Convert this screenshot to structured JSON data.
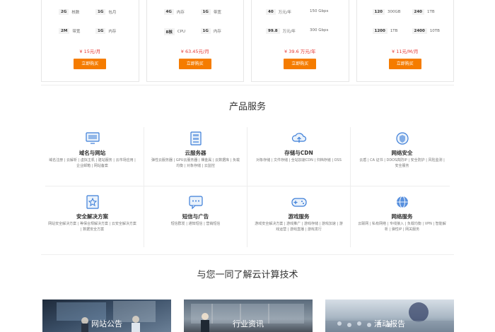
{
  "pricing": [
    {
      "specs": [
        [
          "2G",
          "核数"
        ],
        [
          "1G",
          "包月"
        ],
        [
          "2M",
          "带宽"
        ],
        [
          "1G",
          "内存"
        ]
      ],
      "price": "¥ 15元/月",
      "buy": "立即购买"
    },
    {
      "specs": [
        [
          "4G",
          "内存"
        ],
        [
          "1G",
          "带宽"
        ],
        [
          "8核",
          "CPU"
        ],
        [
          "1G",
          "内存"
        ]
      ],
      "price": "¥ 63.45元/月",
      "buy": "立即购买"
    },
    {
      "specs": [
        [
          "40",
          "万元/年"
        ],
        [
          "150 Gbps",
          ""
        ],
        [
          "99.8",
          "万元/年"
        ],
        [
          "300 Gbps",
          ""
        ]
      ],
      "price": "¥ 39.6 万元/年",
      "buy": "立即购买"
    },
    {
      "specs": [
        [
          "120",
          "300GB"
        ],
        [
          "240",
          "1TB"
        ],
        [
          "1200",
          "1TB"
        ],
        [
          "2400",
          "10TB"
        ]
      ],
      "price": "¥ 11元/M/月",
      "buy": "立即购买"
    }
  ],
  "products_title": "产品服务",
  "products": [
    {
      "name": "域名与网站",
      "icon": "monitor-icon",
      "desc": "域名注册 | 云解析 | 虚拟主机 | 建站服务 | 云市场应用 | 企业邮箱 | 网站备案"
    },
    {
      "name": "云服务器",
      "icon": "server-icon",
      "desc": "弹性云服务器 | GPU云服务器 | 裸金属 | 云数据库 | 负载均衡 | 对象存储 | 云监控"
    },
    {
      "name": "存储与CDN",
      "icon": "cloud-upload-icon",
      "desc": "对象存储 | 文件存储 | 全站加速CDN | 归档存储 | OSS"
    },
    {
      "name": "网络安全",
      "icon": "shield-icon",
      "desc": "云盾 | CA 证书 | DDOS高防IP | 安全防护 | 风险监测 | 安全服务"
    },
    {
      "name": "安全解决方案",
      "icon": "star-icon",
      "desc": "网站安全解决方案 | 等保合规解决方案 | 云安全解决方案 | 数据安全方案"
    },
    {
      "name": "短信与广告",
      "icon": "chat-icon",
      "desc": "短信群发 | 通知短信 | 营销短信"
    },
    {
      "name": "游戏服务",
      "icon": "gamepad-icon",
      "desc": "游戏安全解决方案 | 游戏推广 | 游戏存储 | 游戏加速 | 游戏运营 | 游戏直播 | 游戏发行"
    },
    {
      "name": "网络服务",
      "icon": "globe-icon",
      "desc": "云联网 | 私有网络 | 专线接入 | 负载均衡 | VPN | 智能解析 | 弹性IP | 网关服务"
    }
  ],
  "tech_title": "与您一同了解云计算技术",
  "tiles": [
    {
      "label": "网站公告"
    },
    {
      "label": "行业资讯"
    },
    {
      "label": "活动报告"
    }
  ]
}
